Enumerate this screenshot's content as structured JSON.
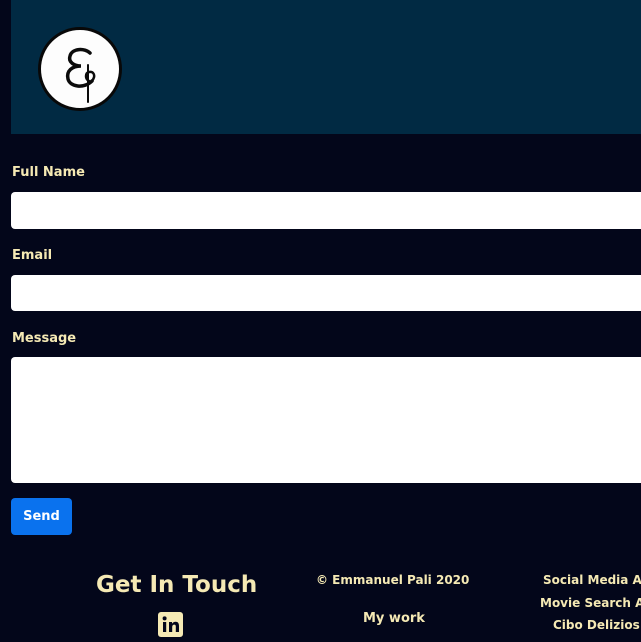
{
  "header": {
    "logo_icon": "monogram-e-logo-icon",
    "background_color": "#012a43"
  },
  "form": {
    "full_name_label": "Full Name",
    "full_name_value": "",
    "email_label": "Email",
    "email_value": "",
    "message_label": "Message",
    "message_value": "",
    "send_label": "Send",
    "send_color": "#0a72ee"
  },
  "footer": {
    "title": "Get In Touch",
    "linkedin_icon": "linkedin-icon",
    "copyright": "© Emmanuel Pali 2020",
    "my_work_label": "My work",
    "projects": [
      "Social Media A",
      "Movie Search A",
      "Cibo Delizios"
    ]
  },
  "colors": {
    "page_background": "#03061a",
    "label_text": "#f5e9b4"
  }
}
